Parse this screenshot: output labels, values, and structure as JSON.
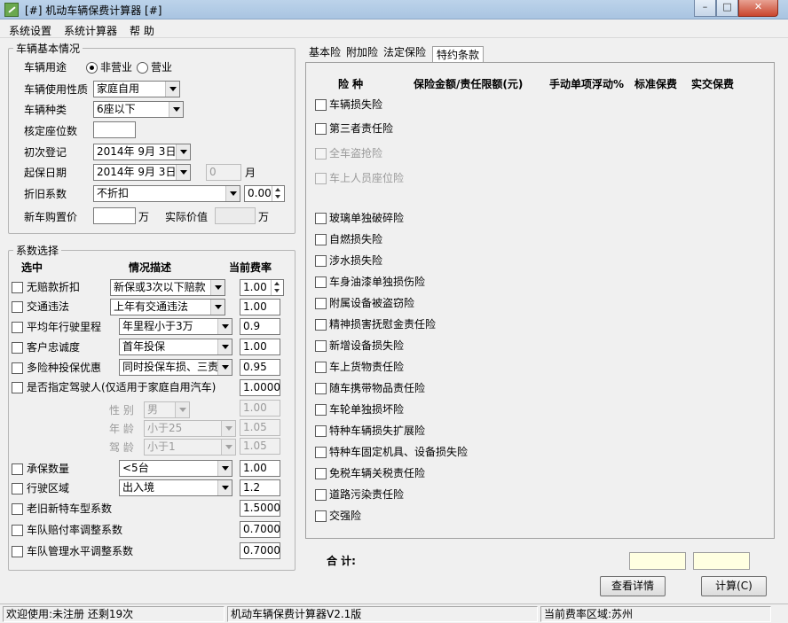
{
  "window": {
    "title": "[#] 机动车辆保费计算器 [#]"
  },
  "menu": [
    "系统设置",
    "系统计算器",
    "帮 助"
  ],
  "vehicle": {
    "legend": "车辆基本情况",
    "usage_label": "车辆用途",
    "usage_options": [
      "非营业",
      "营业"
    ],
    "nature_label": "车辆使用性质",
    "nature_value": "家庭自用",
    "type_label": "车辆种类",
    "type_value": "6座以下",
    "seats_label": "核定座位数",
    "seats_value": "",
    "reg_label": "初次登记",
    "reg_value": "2014年 9月 3日",
    "start_label": "起保日期",
    "start_value": "2014年 9月 3日",
    "months_value": "0",
    "months_unit": "月",
    "depr_label": "折旧系数",
    "depr_value": "不折扣",
    "depr_num": "0.00",
    "price_label": "新车购置价",
    "price_value": "",
    "price_unit": "万",
    "actual_label": "实际价值",
    "actual_value": "",
    "actual_unit": "万"
  },
  "coef": {
    "legend": "系数选择",
    "headers": [
      "选中",
      "情况描述",
      "当前费率"
    ],
    "rows": [
      {
        "label": "无赔款折扣",
        "desc": "新保或3次以下赔款",
        "rate": "1.00"
      },
      {
        "label": "交通违法",
        "desc": "上年有交通违法",
        "rate": "1.00"
      },
      {
        "label": "平均年行驶里程",
        "desc": "年里程小于3万",
        "rate": "0.9"
      },
      {
        "label": "客户忠诚度",
        "desc": "首年投保",
        "rate": "1.00"
      },
      {
        "label": "多险种投保优惠",
        "desc": "同时投保车损、三责",
        "rate": "0.95"
      },
      {
        "label": "是否指定驾驶人(仅适用于家庭自用汽车)",
        "rate": "1.0000"
      }
    ],
    "driver": [
      {
        "label": "性 别",
        "value": "男",
        "rate": "1.00"
      },
      {
        "label": "年 龄",
        "value": "小于25",
        "rate": "1.05"
      },
      {
        "label": "驾 龄",
        "value": "小于1",
        "rate": "1.05"
      }
    ],
    "rows2": [
      {
        "label": "承保数量",
        "desc": "<5台",
        "rate": "1.00"
      },
      {
        "label": "行驶区域",
        "desc": "出入境",
        "rate": "1.2"
      },
      {
        "label": "老旧新特车型系数",
        "rate": "1.5000"
      },
      {
        "label": "车队赔付率调整系数",
        "rate": "0.7000"
      },
      {
        "label": "车队管理水平调整系数",
        "rate": "0.7000"
      }
    ]
  },
  "tabs": [
    "基本险",
    "附加险",
    "法定保险",
    "特约条款"
  ],
  "table_headers": [
    "险  种",
    "保险金额/责任限额(元)",
    "手动单项浮动%",
    "标准保费",
    "实交保费"
  ],
  "insurances": [
    {
      "label": "车辆损失险",
      "enabled": true
    },
    {
      "label": "第三者责任险",
      "enabled": true
    },
    {
      "label": "全车盗抢险",
      "enabled": false
    },
    {
      "label": "车上人员座位险",
      "enabled": false
    },
    {
      "label": "玻璃单独破碎险",
      "enabled": true
    },
    {
      "label": "自燃损失险",
      "enabled": true
    },
    {
      "label": "涉水损失险",
      "enabled": true
    },
    {
      "label": "车身油漆单独损伤险",
      "enabled": true
    },
    {
      "label": "附属设备被盗窃险",
      "enabled": true
    },
    {
      "label": "精神损害抚慰金责任险",
      "enabled": true
    },
    {
      "label": "新增设备损失险",
      "enabled": true
    },
    {
      "label": "车上货物责任险",
      "enabled": true
    },
    {
      "label": "随车携带物品责任险",
      "enabled": true
    },
    {
      "label": "车轮单独损坏险",
      "enabled": true
    },
    {
      "label": "特种车辆损失扩展险",
      "enabled": true
    },
    {
      "label": "特种车固定机具、设备损失险",
      "enabled": true
    },
    {
      "label": "免税车辆关税责任险",
      "enabled": true
    },
    {
      "label": "道路污染责任险",
      "enabled": true
    },
    {
      "label": "交强险",
      "enabled": true
    }
  ],
  "total_label": "合    计:",
  "buttons": {
    "details": "查看详情",
    "calc": "计算(C)"
  },
  "status": [
    "欢迎使用:未注册   还剩19次",
    "机动车辆保费计算器V2.1版",
    "当前费率区域:苏州"
  ]
}
